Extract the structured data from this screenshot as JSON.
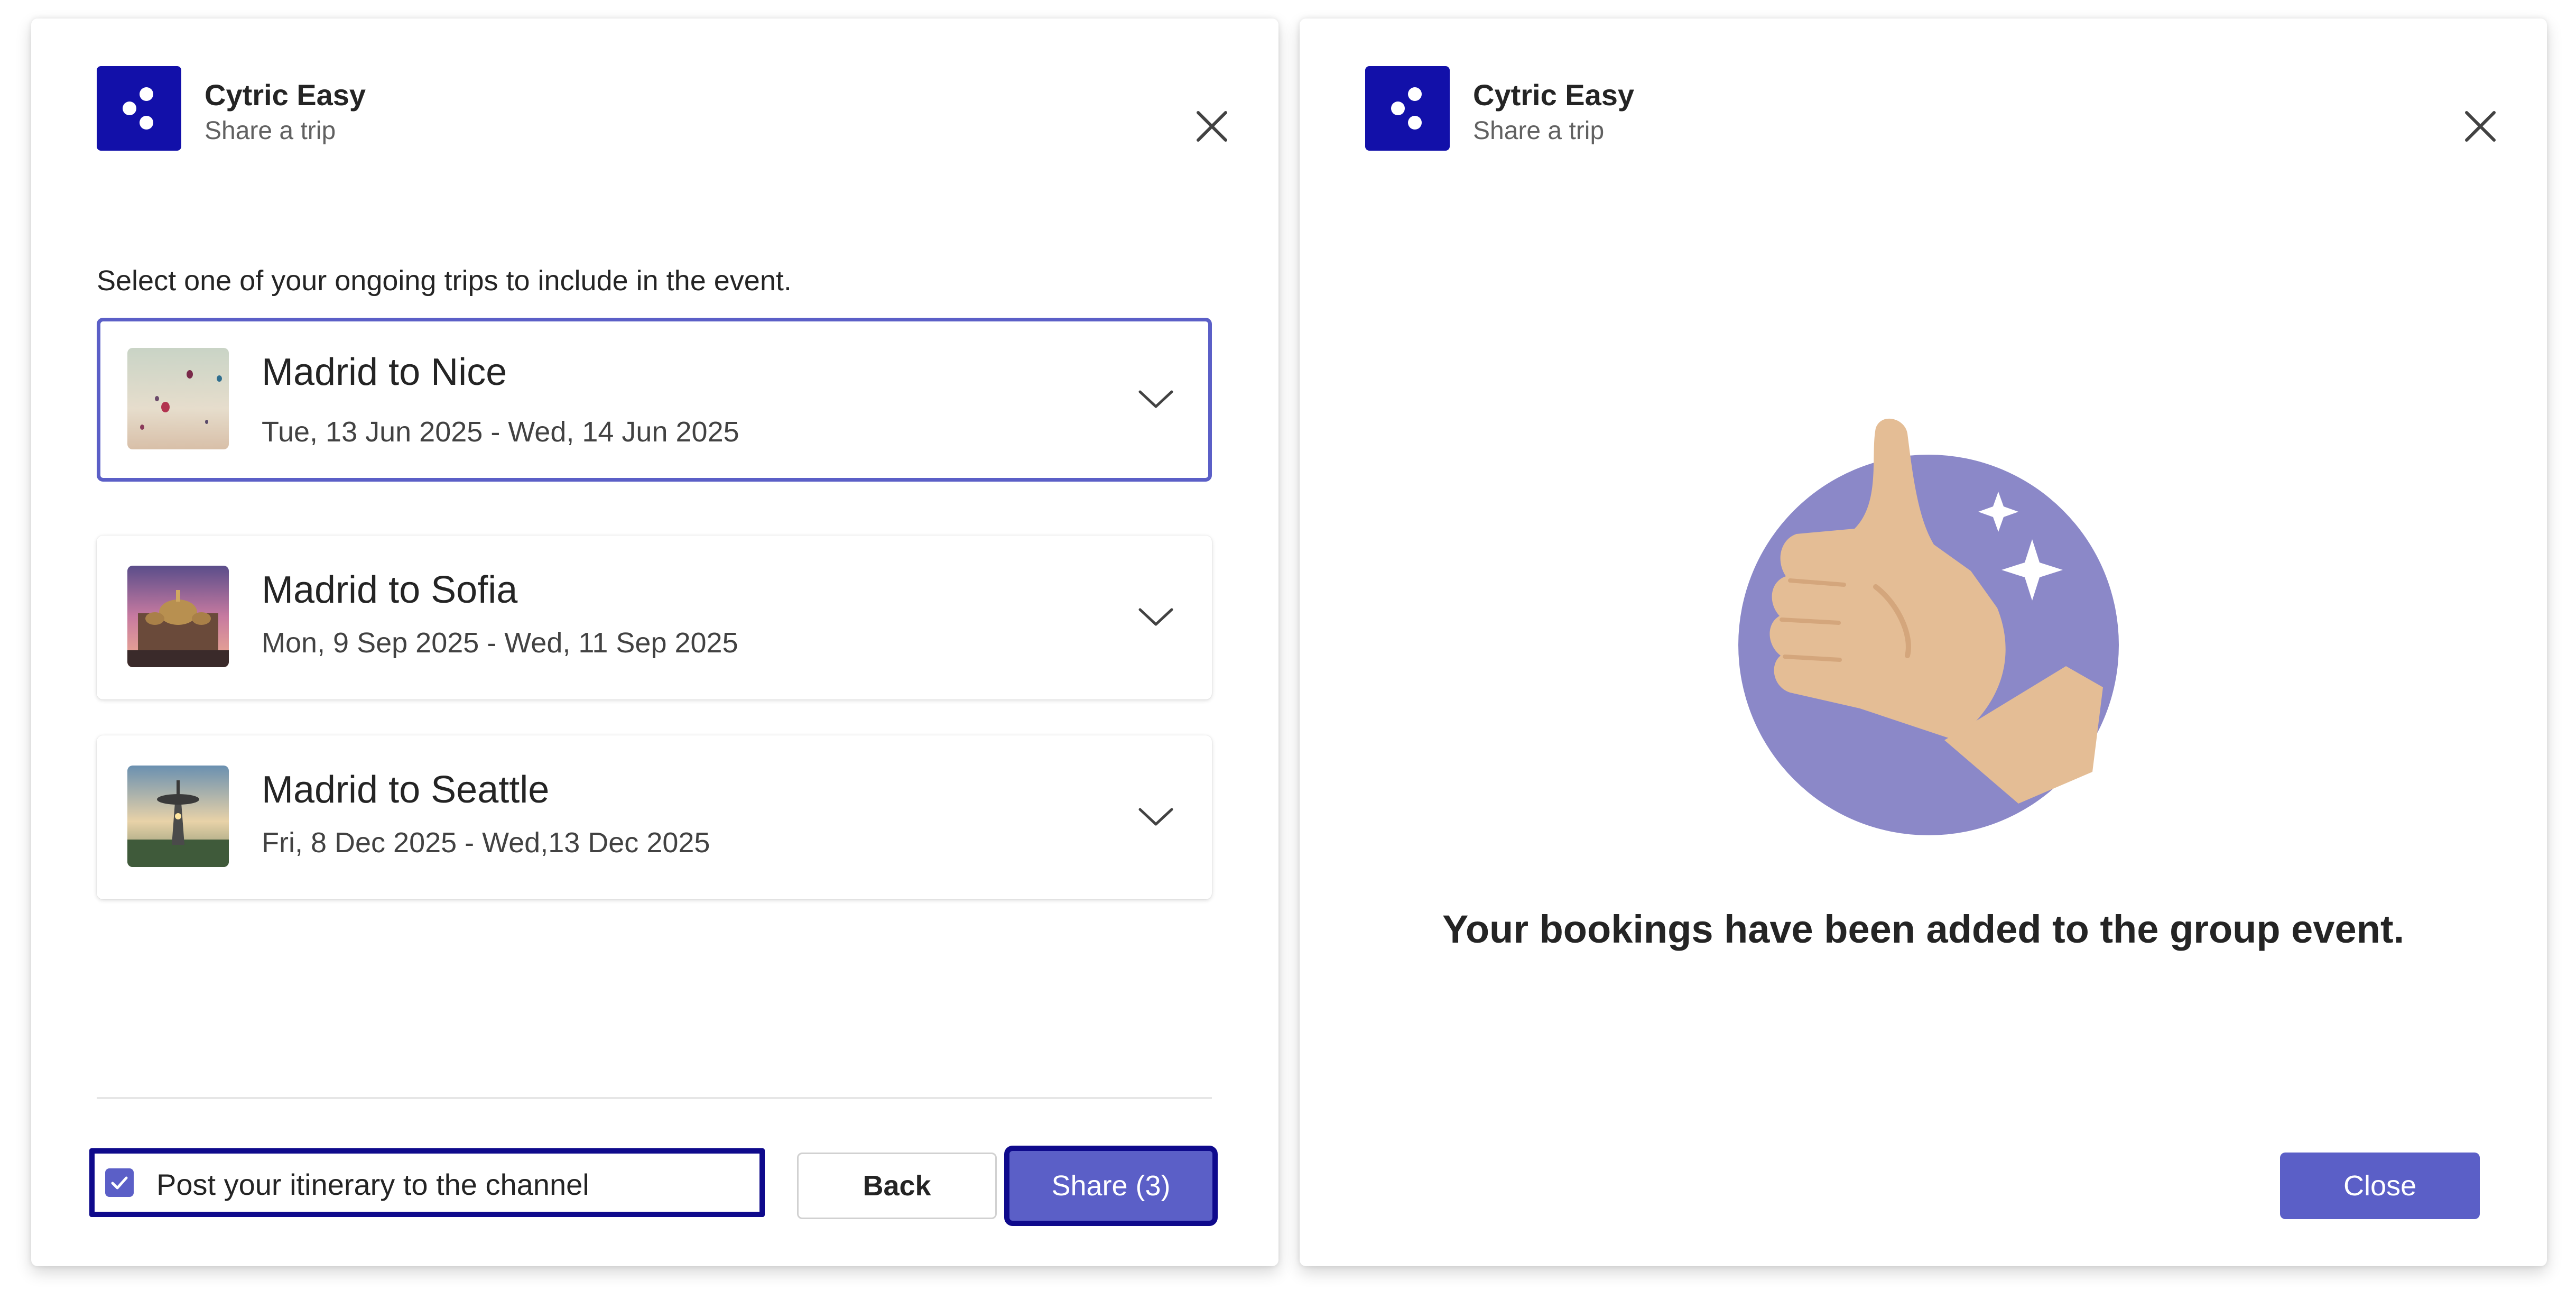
{
  "share_dialog": {
    "app_name": "Cytric Easy",
    "app_subtitle": "Share a trip",
    "instruction": "Select one of your ongoing trips to include in the event.",
    "trips": [
      {
        "title": "Madrid to Nice",
        "dates": "Tue, 13 Jun 2025 - Wed, 14 Jun 2025",
        "selected": true,
        "image": "hot-air-balloons"
      },
      {
        "title": "Madrid to Sofia",
        "dates": "Mon, 9 Sep 2025 - Wed, 11 Sep 2025",
        "selected": false,
        "image": "cathedral-at-sunset"
      },
      {
        "title": "Madrid to Seattle",
        "dates": "Fri, 8 Dec 2025 - Wed,13 Dec 2025",
        "selected": false,
        "image": "space-needle"
      }
    ],
    "post_to_channel_label": "Post your itinerary to the channel",
    "post_to_channel_checked": true,
    "back_label": "Back",
    "share_label": "Share (3)"
  },
  "confirmation_dialog": {
    "app_name": "Cytric Easy",
    "app_subtitle": "Share a trip",
    "message": "Your bookings have been added to the group event.",
    "close_label": "Close",
    "illustration": "thumbs-up"
  },
  "colors": {
    "brand": "#1210a9",
    "accent": "#5b5fc7",
    "focus_outline": "#0f0a8c",
    "illustration_circle": "#8b88c8",
    "illustration_hand": "#e4bd95"
  }
}
